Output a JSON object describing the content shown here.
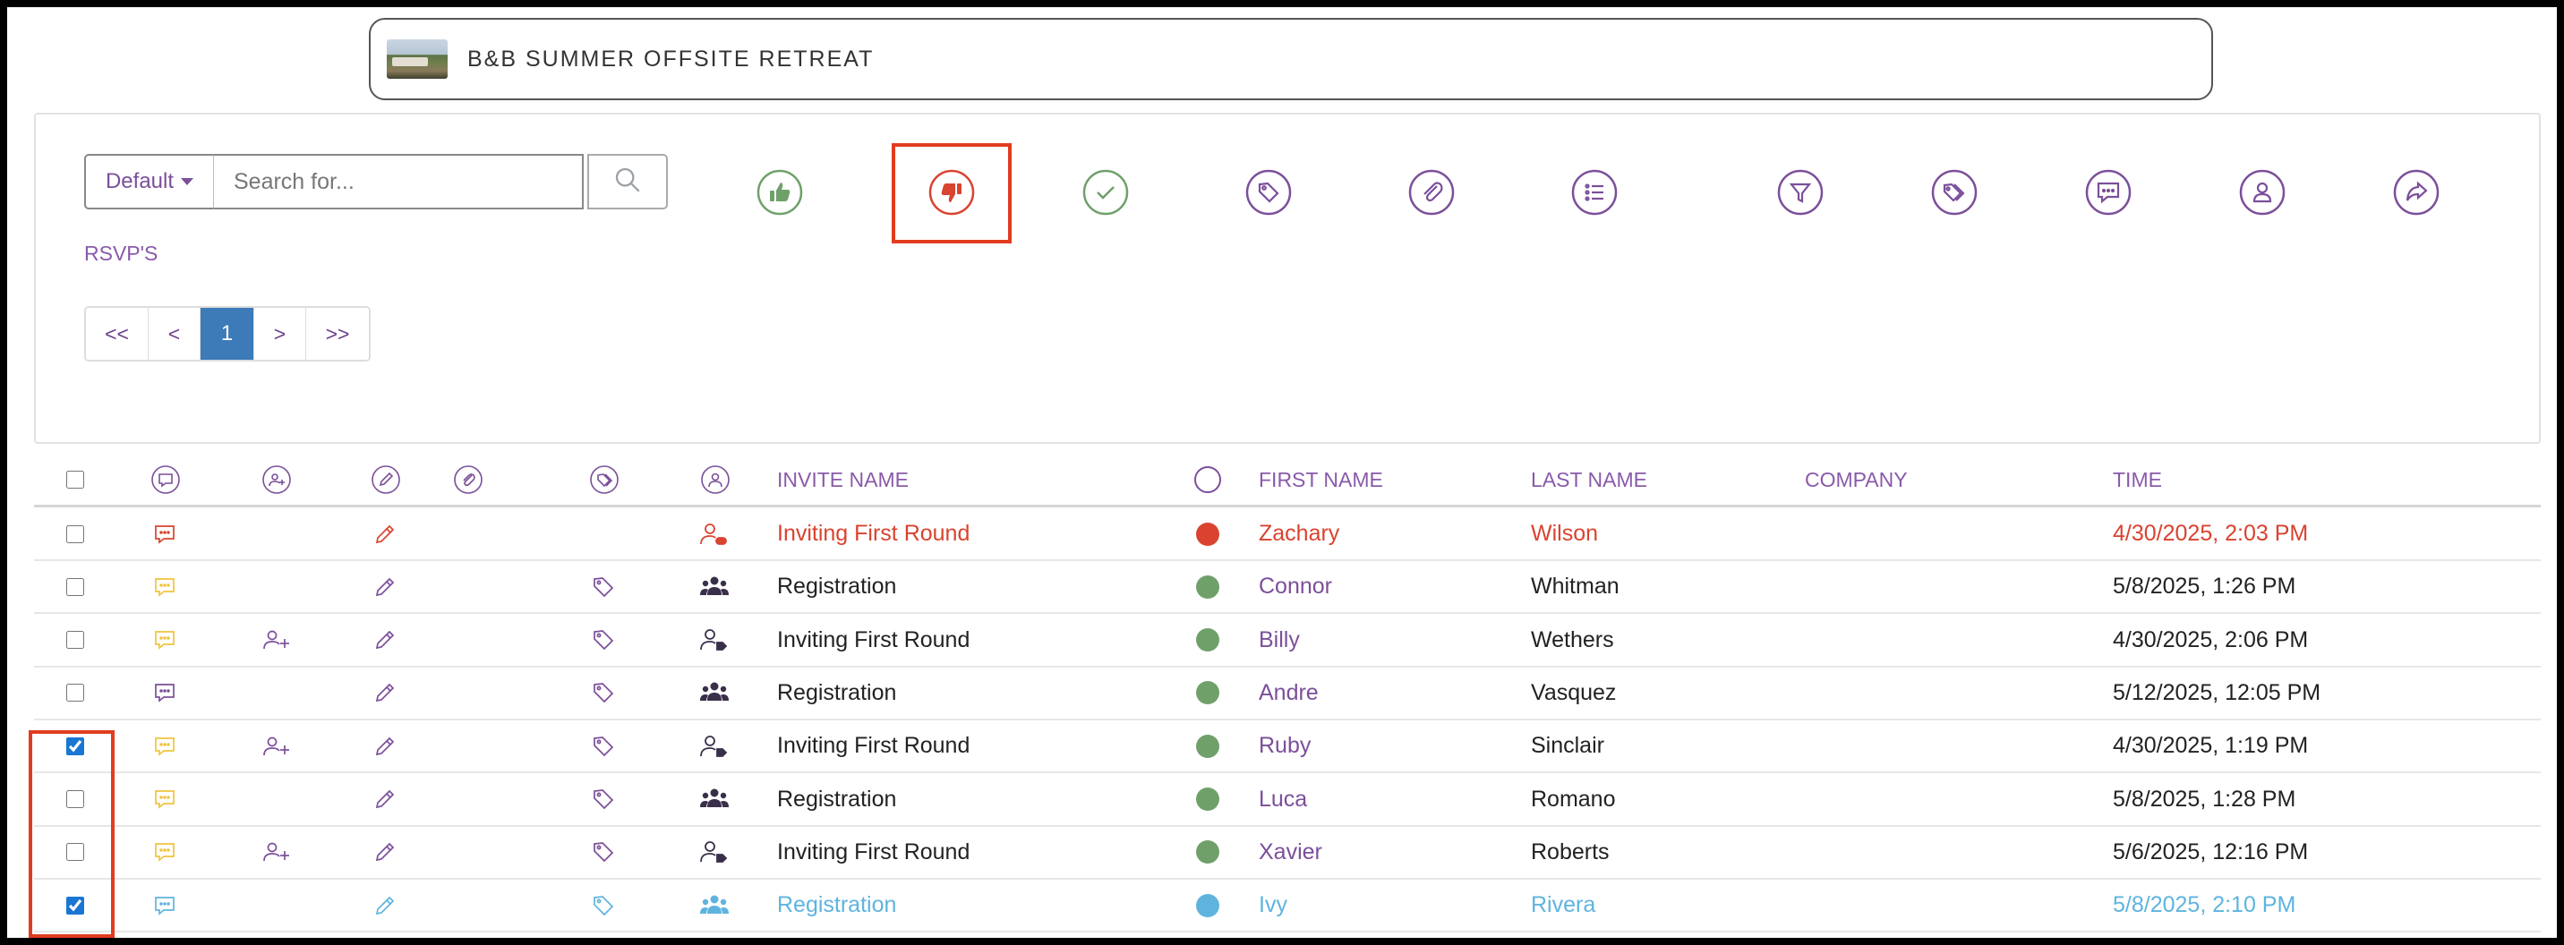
{
  "header": {
    "event_title": "B&B SUMMER OFFSITE RETREAT"
  },
  "toolbar": {
    "view_select": "Default",
    "search_placeholder": "Search for...",
    "section_label": "RSVP'S",
    "pagination": {
      "first": "<<",
      "prev": "<",
      "current": "1",
      "next": ">",
      "last": ">>"
    },
    "icons": [
      "thumbs-up-icon",
      "thumbs-down-icon",
      "check-icon",
      "tag-icon",
      "paperclip-icon",
      "list-icon",
      "filter-icon",
      "tags-icon",
      "chat-icon",
      "user-icon",
      "share-icon"
    ],
    "active_action": "thumbs-down-icon"
  },
  "table": {
    "columns": [
      "INVITE NAME",
      "FIRST NAME",
      "LAST NAME",
      "COMPANY",
      "TIME"
    ],
    "rows": [
      {
        "checked": false,
        "invite": "Inviting First Round",
        "first": "Zachary",
        "last": "Wilson",
        "company": "",
        "time": "4/30/2025, 2:03 PM",
        "status": "declined",
        "add_user": false,
        "tag": false,
        "people": "user-minus"
      },
      {
        "checked": false,
        "invite": "Registration",
        "first": "Connor",
        "last": "Whitman",
        "company": "",
        "time": "5/8/2025, 1:26 PM",
        "status": "accepted",
        "add_user": false,
        "tag": true,
        "people": "group"
      },
      {
        "checked": false,
        "invite": "Inviting First Round",
        "first": "Billy",
        "last": "Wethers",
        "company": "",
        "time": "4/30/2025, 2:06 PM",
        "status": "accepted",
        "add_user": true,
        "tag": true,
        "people": "user-tag"
      },
      {
        "checked": false,
        "invite": "Registration",
        "first": "Andre",
        "last": "Vasquez",
        "company": "",
        "time": "5/12/2025, 12:05 PM",
        "status": "accepted",
        "add_user": false,
        "tag": true,
        "people": "group"
      },
      {
        "checked": true,
        "invite": "Inviting First Round",
        "first": "Ruby",
        "last": "Sinclair",
        "company": "",
        "time": "4/30/2025, 1:19 PM",
        "status": "accepted",
        "add_user": true,
        "tag": true,
        "people": "user-tag"
      },
      {
        "checked": false,
        "invite": "Registration",
        "first": "Luca",
        "last": "Romano",
        "company": "",
        "time": "5/8/2025, 1:28 PM",
        "status": "accepted",
        "add_user": false,
        "tag": true,
        "people": "group"
      },
      {
        "checked": false,
        "invite": "Inviting First Round",
        "first": "Xavier",
        "last": "Roberts",
        "company": "",
        "time": "5/6/2025, 12:16 PM",
        "status": "accepted",
        "add_user": true,
        "tag": true,
        "people": "user-tag"
      },
      {
        "checked": true,
        "invite": "Registration",
        "first": "Ivy",
        "last": "Rivera",
        "company": "",
        "time": "5/8/2025, 2:10 PM",
        "status": "pending",
        "add_user": false,
        "tag": true,
        "people": "group"
      }
    ]
  },
  "colors": {
    "accent": "#7b4f9a",
    "declined": "#d9432f",
    "accepted": "#6fa06a",
    "pending": "#5eb4df",
    "chat_yellow": "#f0c43c",
    "highlight": "#e03c1f",
    "page_active": "#3d7ab8"
  }
}
